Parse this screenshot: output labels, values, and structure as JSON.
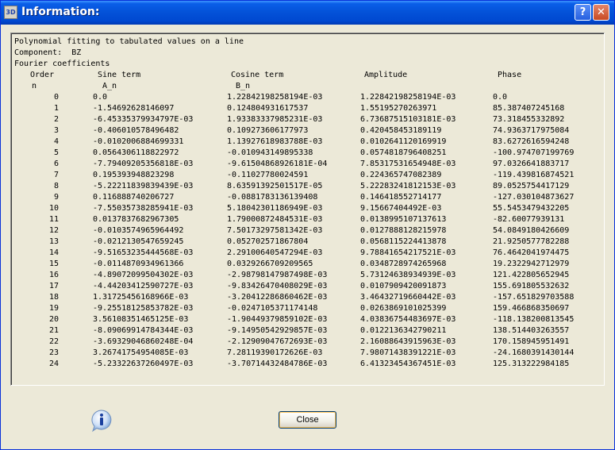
{
  "window": {
    "title": "Information:",
    "app_icon_label": "3D"
  },
  "content": {
    "header_lines": [
      "Polynomial fitting to tabulated values on a line",
      "Component:  BZ",
      "Fourier coefficients"
    ],
    "columns": [
      "Order",
      "Sine term",
      "Cosine term",
      "Amplitude",
      "Phase"
    ],
    "subheaders": [
      "n",
      "A_n",
      "B_n"
    ],
    "rows": [
      [
        "0",
        "0.0",
        "1.22842198258194E-03",
        "1.22842198258194E-03",
        "0.0"
      ],
      [
        "1",
        "-1.54692628146097",
        "0.124804931617537",
        "1.55195270263971",
        "85.387407245168"
      ],
      [
        "2",
        "-6.45335379934797E-03",
        "1.93383337985231E-03",
        "6.73687515103181E-03",
        "73.318455332892"
      ],
      [
        "3",
        "-0.406010578496482",
        "0.109273606177973",
        "0.420458453189119",
        "74.9363717975084"
      ],
      [
        "4",
        "-0.0102006884699331",
        "1.13927618983788E-03",
        "0.0102641120169919",
        "83.6272616594248"
      ],
      [
        "5",
        "0.0564306118822972",
        "-0.010943149895338",
        "0.0574818796408251",
        "-100.974707199769"
      ],
      [
        "6",
        "-7.79409205356818E-03",
        "-9.61504868926181E-04",
        "7.85317531654948E-03",
        "97.0326641883717"
      ],
      [
        "7",
        "0.195393948823298",
        "-0.11027780024591",
        "0.224365747082389",
        "-119.439816874521"
      ],
      [
        "8",
        "-5.22211839839439E-03",
        "8.63591392501517E-05",
        "5.22283241812153E-03",
        "89.0525754417129"
      ],
      [
        "9",
        "0.116888740206727",
        "-0.0881783136139408",
        "0.146418552714177",
        "-127.030104873627"
      ],
      [
        "10",
        "-7.55035738285941E-03",
        "5.18042301186949E-03",
        "9.15667404492E-03",
        "55.5453479432205"
      ],
      [
        "11",
        "0.0137837682967305",
        "1.79000872484531E-03",
        "0.0138995107137613",
        "-82.60077939131"
      ],
      [
        "12",
        "-0.0103574965964492",
        "7.50173297581342E-03",
        "0.0127888128215978",
        "54.0849180426609"
      ],
      [
        "13",
        "-0.0212130547659245",
        "0.052702571867804",
        "0.0568115224413878",
        "21.9250577782288"
      ],
      [
        "14",
        "-9.51653235444568E-03",
        "2.29100640547294E-03",
        "9.78841654217521E-03",
        "76.4642041974475"
      ],
      [
        "15",
        "-0.0114870934961366",
        "0.0329266709209565",
        "0.0348728974265968",
        "19.2322942712979"
      ],
      [
        "16",
        "-4.89072099504302E-03",
        "-2.98798147987498E-03",
        "5.73124638934939E-03",
        "121.422805652945"
      ],
      [
        "17",
        "-4.44203412590727E-03",
        "-9.83426470408029E-03",
        "0.0107909420091873",
        "155.691805532632"
      ],
      [
        "18",
        "1.31725456168966E-03",
        "-3.20412286860462E-03",
        "3.46432719660442E-03",
        "-157.651829703588"
      ],
      [
        "19",
        "-9.25518125853782E-03",
        "-0.0247105371174148",
        "0.0263869101025399",
        "159.466868350697"
      ],
      [
        "20",
        "3.56108351465125E-03",
        "-1.90449379859102E-03",
        "4.03836754483697E-03",
        "-118.138200813545"
      ],
      [
        "21",
        "-8.09069914784344E-03",
        "-9.14950542929857E-03",
        "0.0122136342790211",
        "138.514403263557"
      ],
      [
        "22",
        "-3.69329046860248E-04",
        "-2.12909047672693E-03",
        "2.16088643915963E-03",
        "170.158945951491"
      ],
      [
        "23",
        "3.26741754954085E-03",
        "7.28119390172626E-03",
        "7.98071438391221E-03",
        "-24.1680391430144"
      ],
      [
        "24",
        "-5.23322637260497E-03",
        "-3.70714432484786E-03",
        "6.41323454367451E-03",
        "125.313222984185"
      ]
    ]
  },
  "footer": {
    "close_label": "Close",
    "info_icon": "info-icon"
  },
  "colors": {
    "titlebar": "#0453d9",
    "dialog_bg": "#ece9d8",
    "text": "#000000"
  }
}
